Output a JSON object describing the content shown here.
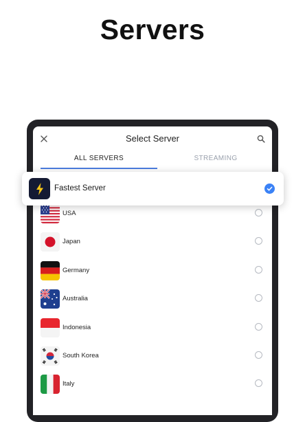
{
  "headline": "Servers",
  "dialog": {
    "title": "Select Server",
    "close_icon": "close-icon",
    "search_icon": "search-icon"
  },
  "tabs": [
    {
      "label": "ALL SERVERS",
      "active": true
    },
    {
      "label": "STREAMING",
      "active": false
    }
  ],
  "fastest": {
    "label": "Fastest Server",
    "icon": "lightning-bolt-icon",
    "selected": true
  },
  "servers": [
    {
      "name": "USA",
      "flag": "us-flag-icon",
      "selected": false
    },
    {
      "name": "Japan",
      "flag": "japan-flag-icon",
      "selected": false
    },
    {
      "name": "Germany",
      "flag": "germany-flag-icon",
      "selected": false
    },
    {
      "name": "Australia",
      "flag": "australia-flag-icon",
      "selected": false
    },
    {
      "name": "Indonesia",
      "flag": "indonesia-flag-icon",
      "selected": false
    },
    {
      "name": "South Korea",
      "flag": "south-korea-flag-icon",
      "selected": false
    },
    {
      "name": "Italy",
      "flag": "italy-flag-icon",
      "selected": false
    }
  ],
  "colors": {
    "accent": "#3b82f6",
    "tab_underline": "#4b7de0",
    "bolt_bg": "#141a33",
    "bolt": "#f5c518"
  }
}
